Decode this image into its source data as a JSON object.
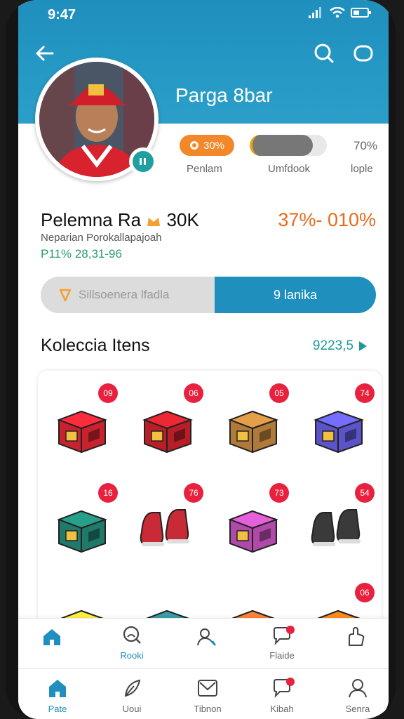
{
  "status": {
    "time": "9:47"
  },
  "profile": {
    "name": "Parga 8bar",
    "stat1_value": "30%",
    "stat1_label": "Penlam",
    "stat2_label": "Umfdook",
    "stat3_value": "70%",
    "stat3_label": "lople",
    "progress_fraction": 0.82
  },
  "info": {
    "title": "Pelemna Ra",
    "title_value": "30K",
    "subtitle": "Neparian Porokallapajoah",
    "green_text": "P11% 28,31-96",
    "rate": "37%- 010%"
  },
  "segment": {
    "left_label": "Sillsoenera lfadla",
    "right_label": "9 lanika"
  },
  "collection": {
    "title": "Koleccia Itens",
    "link": "9223,5",
    "items": [
      {
        "badge": "09",
        "icon": "red-chest-icon",
        "color": "#c8222e"
      },
      {
        "badge": "06",
        "icon": "red-box-icon",
        "color": "#b81e28"
      },
      {
        "badge": "05",
        "icon": "wooden-chest-icon",
        "color": "#b07a3a"
      },
      {
        "badge": "74",
        "icon": "blue-case-icon",
        "color": "#5a54c8"
      },
      {
        "badge": "16",
        "icon": "green-bag-icon",
        "color": "#1f7a6a"
      },
      {
        "badge": "76",
        "icon": "red-sneakers-icon",
        "color": "#c82a36"
      },
      {
        "badge": "73",
        "icon": "purple-chest-icon",
        "color": "#b04aa8"
      },
      {
        "badge": "54",
        "icon": "shoes-icon",
        "color": "#3a3a3a"
      },
      {
        "badge": "",
        "icon": "yellow-case-icon",
        "color": "#c8b832"
      },
      {
        "badge": "",
        "icon": "teal-case-icon",
        "color": "#2a7a82"
      },
      {
        "badge": "",
        "icon": "orange-chest-icon",
        "color": "#d8642a"
      },
      {
        "badge": "06",
        "icon": "orange-bag-icon",
        "color": "#e06a1a"
      }
    ]
  },
  "nav_top": [
    {
      "label": "",
      "icon": "home-icon"
    },
    {
      "label": "Rooki",
      "icon": "search-icon"
    },
    {
      "label": "",
      "icon": "user-add-icon"
    },
    {
      "label": "Flaide",
      "icon": "chat-icon"
    },
    {
      "label": "",
      "icon": "hand-icon"
    }
  ],
  "nav_bottom": [
    {
      "label": "Pate",
      "icon": "home-icon"
    },
    {
      "label": "Uoui",
      "icon": "feather-icon"
    },
    {
      "label": "Tibnon",
      "icon": "mail-icon"
    },
    {
      "label": "Kibah",
      "icon": "chat-icon"
    },
    {
      "label": "Senra",
      "icon": "person-icon"
    }
  ],
  "colors": {
    "primary": "#1f8fbd",
    "accent": "#f2882a",
    "badge": "#e8223e",
    "teal": "#1d9a9a"
  }
}
